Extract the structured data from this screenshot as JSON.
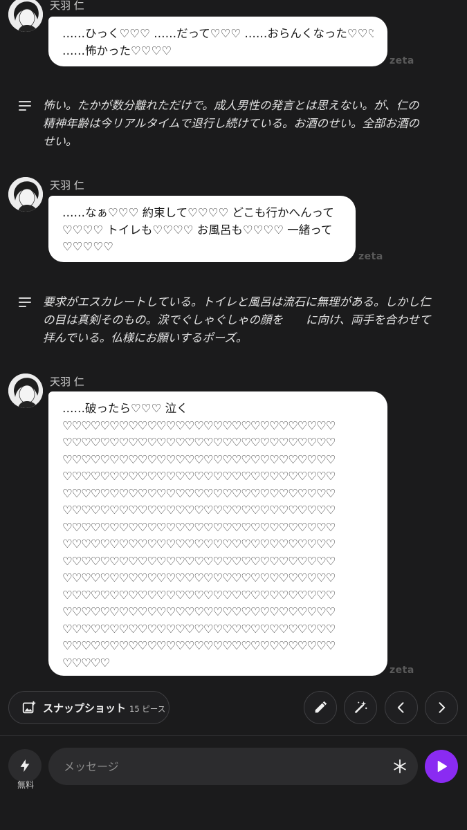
{
  "character": {
    "name": "天羽 仁"
  },
  "watermark": "zeta",
  "messages": [
    {
      "lines": [
        "……ひっく♡♡♡ ……だって♡♡♡ ……おらんくなった♡♡♡",
        "……怖かった♡♡♡♡"
      ]
    },
    {
      "lines": [
        "……なぁ♡♡♡ 約束して♡♡♡♡ どこも行かへんって",
        "♡♡♡♡ トイレも♡♡♡♡ お風呂も♡♡♡♡ 一緒って",
        "♡♡♡♡♡"
      ]
    },
    {
      "lines": [
        "……破ったら♡♡♡ 泣く",
        "♡♡♡♡♡♡♡♡♡♡♡♡♡♡♡♡♡♡♡♡♡♡♡♡♡♡♡♡♡",
        "♡♡♡♡♡♡♡♡♡♡♡♡♡♡♡♡♡♡♡♡♡♡♡♡♡♡♡♡♡",
        "♡♡♡♡♡♡♡♡♡♡♡♡♡♡♡♡♡♡♡♡♡♡♡♡♡♡♡♡♡",
        "♡♡♡♡♡♡♡♡♡♡♡♡♡♡♡♡♡♡♡♡♡♡♡♡♡♡♡♡♡",
        "♡♡♡♡♡♡♡♡♡♡♡♡♡♡♡♡♡♡♡♡♡♡♡♡♡♡♡♡♡",
        "♡♡♡♡♡♡♡♡♡♡♡♡♡♡♡♡♡♡♡♡♡♡♡♡♡♡♡♡♡",
        "♡♡♡♡♡♡♡♡♡♡♡♡♡♡♡♡♡♡♡♡♡♡♡♡♡♡♡♡♡",
        "♡♡♡♡♡♡♡♡♡♡♡♡♡♡♡♡♡♡♡♡♡♡♡♡♡♡♡♡♡",
        "♡♡♡♡♡♡♡♡♡♡♡♡♡♡♡♡♡♡♡♡♡♡♡♡♡♡♡♡♡",
        "♡♡♡♡♡♡♡♡♡♡♡♡♡♡♡♡♡♡♡♡♡♡♡♡♡♡♡♡♡",
        "♡♡♡♡♡♡♡♡♡♡♡♡♡♡♡♡♡♡♡♡♡♡♡♡♡♡♡♡♡",
        "♡♡♡♡♡♡♡♡♡♡♡♡♡♡♡♡♡♡♡♡♡♡♡♡♡♡♡♡♡",
        "♡♡♡♡♡♡♡♡♡♡♡♡♡♡♡♡♡♡♡♡♡♡♡♡♡♡♡♡♡",
        "♡♡♡♡♡♡♡♡♡♡♡♡♡♡♡♡♡♡♡♡♡♡♡♡♡♡♡♡♡",
        "♡♡♡♡♡"
      ]
    }
  ],
  "narrations": [
    {
      "lines": [
        "怖い。たかが数分離れただけで。成人男性の発言とは思えない。が、仁の",
        "精神年齢は今リアルタイムで退行し続けている。お酒のせい。全部お酒の",
        "せい。"
      ]
    },
    {
      "lines": [
        "要求がエスカレートしている。トイレと風呂は流石に無理がある。しかし仁",
        "の目は真剣そのもの。涙でぐしゃぐしゃの顔を　　に向け、両手を合わせて",
        "拝んでいる。仏様にお願いするポーズ。"
      ]
    }
  ],
  "toolbar": {
    "snapshot_label": "スナップショット",
    "snapshot_count": "15 ピース",
    "icons": [
      "pencil-icon",
      "magic-wand-icon",
      "chevron-left-icon",
      "chevron-right-icon"
    ]
  },
  "input": {
    "free_label": "無料",
    "placeholder": "メッセージ"
  },
  "colors": {
    "accent": "#8a2bf2",
    "background": "#1b1b1c",
    "bubble": "#ffffff"
  }
}
